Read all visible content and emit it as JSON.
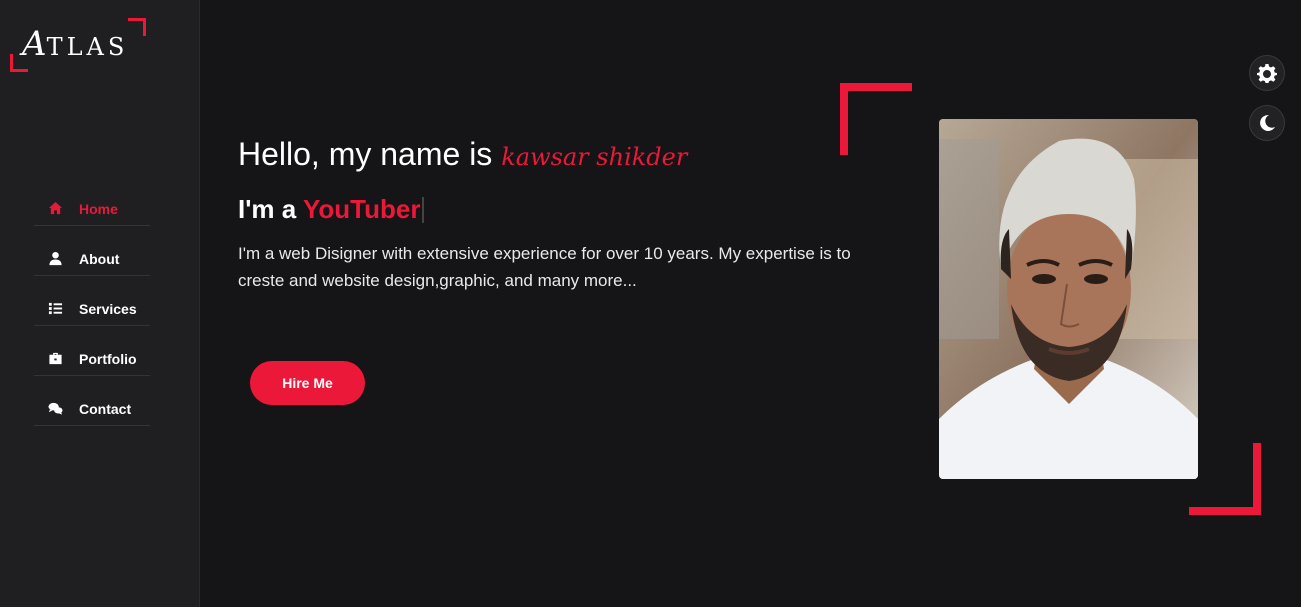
{
  "brand": {
    "logo_letter": "A",
    "logo_rest": "TLAS"
  },
  "nav": {
    "items": [
      {
        "label": "Home",
        "icon": "home-icon",
        "active": true
      },
      {
        "label": "About",
        "icon": "user-icon",
        "active": false
      },
      {
        "label": "Services",
        "icon": "list-icon",
        "active": false
      },
      {
        "label": "Portfolio",
        "icon": "briefcase-icon",
        "active": false
      },
      {
        "label": "Contact",
        "icon": "comments-icon",
        "active": false
      }
    ]
  },
  "hero": {
    "greeting": "Hello, my name is",
    "name": "kawsar shikder",
    "role_prefix": "I'm a",
    "role": "YouTuber",
    "description": "I'm a web Disigner with extensive experience for over 10 years. My expertise is to creste and website design,graphic, and many more...",
    "cta_label": "Hire Me"
  },
  "controls": {
    "settings_icon": "gear-icon",
    "theme_icon": "moon-icon"
  },
  "colors": {
    "accent": "#ec1839",
    "background": "#151416",
    "sidebar": "#1f1e20"
  }
}
